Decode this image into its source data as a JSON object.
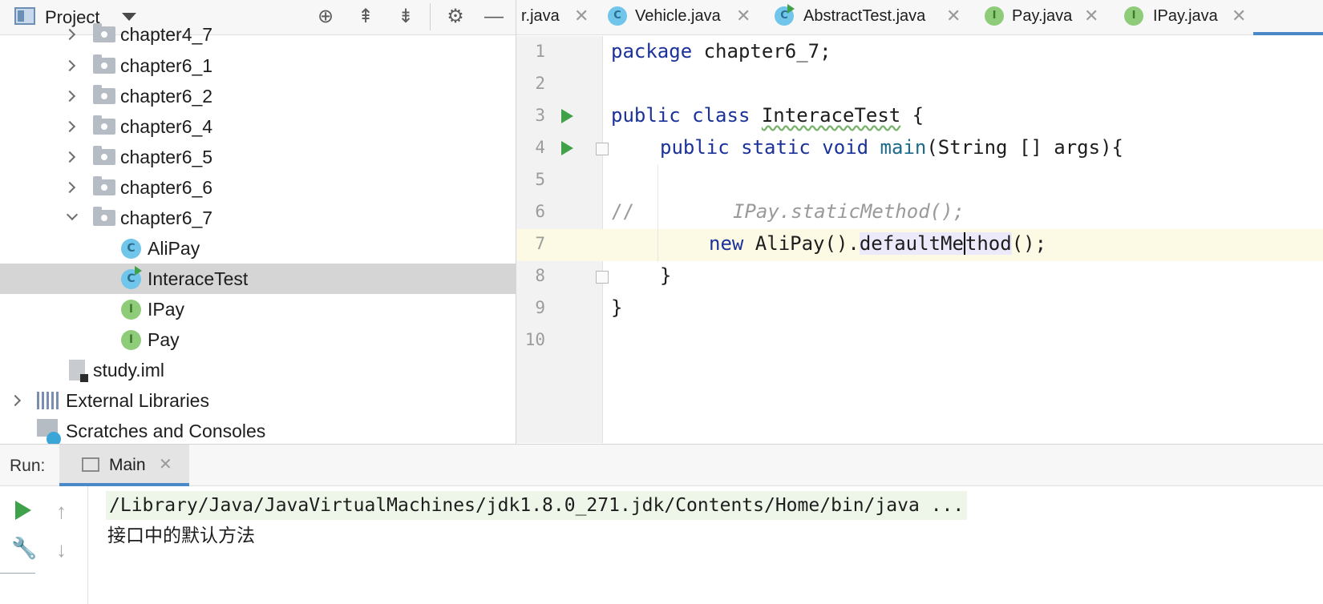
{
  "project": {
    "title": "Project",
    "tree": [
      {
        "label": "chapter4_7",
        "type": "folder"
      },
      {
        "label": "chapter6_1",
        "type": "folder"
      },
      {
        "label": "chapter6_2",
        "type": "folder"
      },
      {
        "label": "chapter6_4",
        "type": "folder"
      },
      {
        "label": "chapter6_5",
        "type": "folder"
      },
      {
        "label": "chapter6_6",
        "type": "folder"
      },
      {
        "label": "chapter6_7",
        "type": "folder",
        "expanded": true
      },
      {
        "label": "AliPay",
        "type": "class"
      },
      {
        "label": "InteraceTest",
        "type": "class",
        "selected": true
      },
      {
        "label": "IPay",
        "type": "interface"
      },
      {
        "label": "Pay",
        "type": "interface"
      },
      {
        "label": "study.iml",
        "type": "file"
      },
      {
        "label": "External Libraries",
        "type": "libraries"
      },
      {
        "label": "Scratches and Consoles",
        "type": "scratches"
      }
    ]
  },
  "tabs": [
    {
      "label": "r.java",
      "icon": "none"
    },
    {
      "label": "Vehicle.java",
      "icon": "class-icon",
      "icon_letter": "C"
    },
    {
      "label": "AbstractTest.java",
      "icon": "class-icon"
    },
    {
      "label": "Pay.java",
      "icon": "interface-icon",
      "icon_letter": "I"
    },
    {
      "label": "IPay.java",
      "icon": "interface-icon",
      "icon_letter": "I"
    }
  ],
  "editor": {
    "line_numbers": [
      "1",
      "2",
      "3",
      "4",
      "5",
      "6",
      "7",
      "8",
      "9",
      "10"
    ],
    "current_line": 7,
    "code": {
      "l1_kw": "package",
      "l1_rest": " chapter6_7;",
      "l3_kw": "public class",
      "l3_name": "InteraceTest",
      "l3_rest": " {",
      "l4_kw": "public static void",
      "l4_fn": "main",
      "l4_rest": "(String [] args){",
      "l6_prefix": "//",
      "l6_comment": "IPay.staticMethod();",
      "l7_kw": "new",
      "l7_mid": " AliPay().",
      "l7_hl_a": "defaultMe",
      "l7_hl_b": "thod",
      "l7_rest": "();",
      "l8": "}",
      "l9": "}"
    }
  },
  "run": {
    "title": "Run:",
    "tab_label": "Main",
    "command": "/Library/Java/JavaVirtualMachines/jdk1.8.0_271.jdk/Contents/Home/bin/java ...",
    "output": "接口中的默认方法"
  },
  "icons": {
    "close_glyph": "✕",
    "locate_glyph": "⊕",
    "expand_glyph": "⇞",
    "collapse_glyph": "⇟",
    "settings_glyph": "⚙",
    "hide_glyph": "—",
    "wrench_glyph": "🔧",
    "up_glyph": "↑",
    "down_glyph": "↓"
  }
}
